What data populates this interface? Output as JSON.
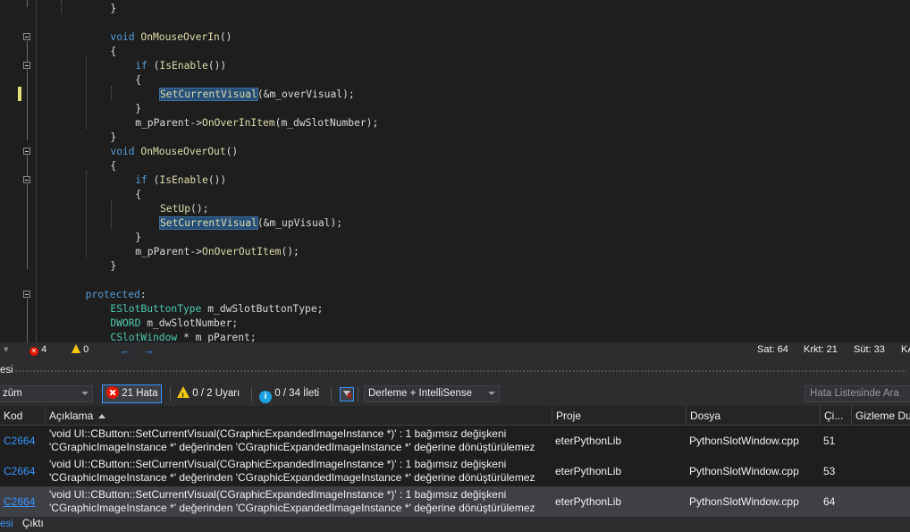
{
  "editor": {
    "lines": [
      {
        "indent": 12,
        "tokens": [
          {
            "t": "}",
            "c": "pl"
          }
        ]
      },
      {
        "indent": 0,
        "tokens": []
      },
      {
        "indent": 12,
        "tokens": [
          {
            "t": "void ",
            "c": "kw"
          },
          {
            "t": "OnMouseOverIn",
            "c": "fn"
          },
          {
            "t": "()",
            "c": "pl"
          }
        ]
      },
      {
        "indent": 12,
        "tokens": [
          {
            "t": "{",
            "c": "pl"
          }
        ]
      },
      {
        "indent": 16,
        "tokens": [
          {
            "t": "if ",
            "c": "kw"
          },
          {
            "t": "(",
            "c": "pl"
          },
          {
            "t": "IsEnable",
            "c": "fn"
          },
          {
            "t": "())",
            "c": "pl"
          }
        ]
      },
      {
        "indent": 16,
        "tokens": [
          {
            "t": "{",
            "c": "pl"
          }
        ]
      },
      {
        "indent": 20,
        "tokens": [
          {
            "t": "SetCurrentVisual",
            "c": "fn hl"
          },
          {
            "t": "(&",
            "c": "pl"
          },
          {
            "t": "m_overVisual",
            "c": "mb"
          },
          {
            "t": ");",
            "c": "pl"
          }
        ]
      },
      {
        "indent": 16,
        "tokens": [
          {
            "t": "}",
            "c": "pl"
          }
        ]
      },
      {
        "indent": 16,
        "tokens": [
          {
            "t": "m_pParent",
            "c": "mb"
          },
          {
            "t": "->",
            "c": "pl"
          },
          {
            "t": "OnOverInItem",
            "c": "fn"
          },
          {
            "t": "(",
            "c": "pl"
          },
          {
            "t": "m_dwSlotNumber",
            "c": "mb"
          },
          {
            "t": ");",
            "c": "pl"
          }
        ]
      },
      {
        "indent": 12,
        "tokens": [
          {
            "t": "}",
            "c": "pl"
          }
        ]
      },
      {
        "indent": 12,
        "tokens": [
          {
            "t": "void ",
            "c": "kw"
          },
          {
            "t": "OnMouseOverOut",
            "c": "fn"
          },
          {
            "t": "()",
            "c": "pl"
          }
        ]
      },
      {
        "indent": 12,
        "tokens": [
          {
            "t": "{",
            "c": "pl"
          }
        ]
      },
      {
        "indent": 16,
        "tokens": [
          {
            "t": "if ",
            "c": "kw"
          },
          {
            "t": "(",
            "c": "pl"
          },
          {
            "t": "IsEnable",
            "c": "fn"
          },
          {
            "t": "())",
            "c": "pl"
          }
        ]
      },
      {
        "indent": 16,
        "tokens": [
          {
            "t": "{",
            "c": "pl"
          }
        ]
      },
      {
        "indent": 20,
        "tokens": [
          {
            "t": "SetUp",
            "c": "fn"
          },
          {
            "t": "();",
            "c": "pl"
          }
        ]
      },
      {
        "indent": 20,
        "tokens": [
          {
            "t": "SetCurrentVisual",
            "c": "fn hl"
          },
          {
            "t": "(&",
            "c": "pl"
          },
          {
            "t": "m_upVisual",
            "c": "mb"
          },
          {
            "t": ");",
            "c": "pl"
          }
        ]
      },
      {
        "indent": 16,
        "tokens": [
          {
            "t": "}",
            "c": "pl"
          }
        ]
      },
      {
        "indent": 16,
        "tokens": [
          {
            "t": "m_pParent",
            "c": "mb"
          },
          {
            "t": "->",
            "c": "pl"
          },
          {
            "t": "OnOverOutItem",
            "c": "fn"
          },
          {
            "t": "();",
            "c": "pl"
          }
        ]
      },
      {
        "indent": 12,
        "tokens": [
          {
            "t": "}",
            "c": "pl"
          }
        ]
      },
      {
        "indent": 0,
        "tokens": []
      },
      {
        "indent": 8,
        "tokens": [
          {
            "t": "protected",
            "c": "kw"
          },
          {
            "t": ":",
            "c": "pl"
          }
        ]
      },
      {
        "indent": 12,
        "tokens": [
          {
            "t": "ESlotButtonType ",
            "c": "ty"
          },
          {
            "t": "m_dwSlotButtonType;",
            "c": "mb"
          }
        ]
      },
      {
        "indent": 12,
        "tokens": [
          {
            "t": "DWORD ",
            "c": "ty"
          },
          {
            "t": "m_dwSlotNumber;",
            "c": "mb"
          }
        ]
      },
      {
        "indent": 12,
        "tokens": [
          {
            "t": "CSlotWindow ",
            "c": "ty"
          },
          {
            "t": "* m_pParent;",
            "c": "mb"
          }
        ]
      }
    ]
  },
  "status_bar": {
    "errors": "4",
    "warnings": "0",
    "line": "Sat: 64",
    "char": "Krkt: 21",
    "col": "Süt: 33",
    "cut": "KA"
  },
  "panel": {
    "title": "esi"
  },
  "toolbar": {
    "scope": "züm",
    "errors_btn": "21 Hata",
    "warnings_btn": "0 / 2 Uyarı",
    "messages_btn": "0 / 34 İleti",
    "build_filter": "Derleme + IntelliSense",
    "search_placeholder": "Hata Listesinde Ara"
  },
  "table": {
    "headers": {
      "code": "Kod",
      "description": "Açıklama",
      "project": "Proje",
      "file": "Dosya",
      "line": "Çi...",
      "suppression": "Gizleme Du"
    },
    "rows": [
      {
        "code": "C2664",
        "desc1": "'void UI::CButton::SetCurrentVisual(CGraphicExpandedImageInstance *)' : 1 bağımsız değişkeni",
        "desc2": "'CGraphicImageInstance *' değerinden 'CGraphicExpandedImageInstance *' değerine dönüştürülemez",
        "project": "eterPythonLib",
        "file": "PythonSlotWindow.cpp",
        "line": "51"
      },
      {
        "code": "C2664",
        "desc1": "'void UI::CButton::SetCurrentVisual(CGraphicExpandedImageInstance *)' : 1 bağımsız değişkeni",
        "desc2": "'CGraphicImageInstance *' değerinden 'CGraphicExpandedImageInstance *' değerine dönüştürülemez",
        "project": "eterPythonLib",
        "file": "PythonSlotWindow.cpp",
        "line": "53"
      },
      {
        "code": "C2664",
        "desc1": "'void UI::CButton::SetCurrentVisual(CGraphicExpandedImageInstance *)' : 1 bağımsız değişkeni",
        "desc2": "'CGraphicImageInstance *' değerinden 'CGraphicExpandedImageInstance *' değerine dönüştürülemez",
        "project": "eterPythonLib",
        "file": "PythonSlotWindow.cpp",
        "line": "64"
      }
    ]
  },
  "bottom_tabs": {
    "tab1": "esi",
    "tab2": "Çıktı"
  },
  "colors": {
    "keyword": "#569cd6",
    "function": "#dcdcaa",
    "type": "#4ec9b0",
    "link": "#3794ff",
    "error": "#e51400",
    "warning": "#f2c811"
  }
}
